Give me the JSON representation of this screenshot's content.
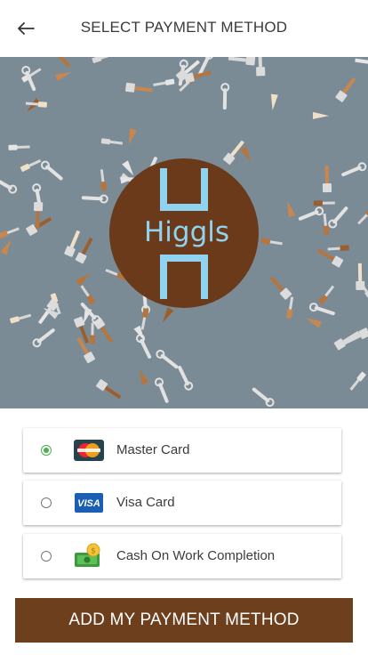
{
  "header": {
    "title": "SELECT PAYMENT METHOD",
    "back_icon": "arrow-left-icon"
  },
  "banner": {
    "logo_text": "Higgls",
    "background_color": "#7a8b96",
    "logo_color": "#6b3a1a",
    "logo_accent": "#8fd3f0"
  },
  "payment_methods": [
    {
      "label": "Master Card",
      "icon": "mastercard-icon",
      "selected": true
    },
    {
      "label": "Visa Card",
      "icon": "visa-icon",
      "selected": false
    },
    {
      "label": "Cash On Work Completion",
      "icon": "cash-icon",
      "selected": false
    }
  ],
  "action": {
    "label": "ADD MY PAYMENT METHOD",
    "color": "#6e3f1d"
  }
}
